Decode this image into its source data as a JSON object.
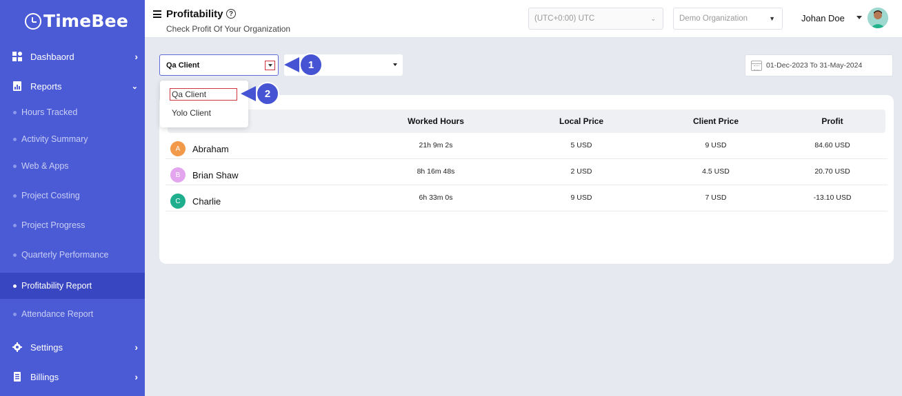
{
  "brand": {
    "logo_text": "TimeBee"
  },
  "sidebar": {
    "dashboard": "Dashbaord",
    "reports": "Reports",
    "sub_items": [
      "Hours Tracked",
      "Activity Summary",
      "Web & Apps",
      "Project Costing",
      "Project Progress",
      "Quarterly Performance",
      "Profitability Report",
      "Attendance Report"
    ],
    "active_item": "Profitability Report",
    "settings": "Settings",
    "billings": "Billings"
  },
  "header": {
    "title": "Profitability",
    "subtitle": "Check Profit Of Your Organization",
    "timezone": "(UTC+0:00) UTC",
    "organization": "Demo Organization",
    "user_name": "Johan Doe"
  },
  "filters": {
    "client_selected": "Qa Client",
    "client_options": [
      "Qa Client",
      "Yolo Client"
    ],
    "date_range": "01-Dec-2023 To 31-May-2024"
  },
  "callouts": [
    "1",
    "2"
  ],
  "table": {
    "headers": [
      "Worked Hours",
      "Local Price",
      "Client Price",
      "Profit"
    ],
    "rows": [
      {
        "initial": "A",
        "name": "Abraham",
        "worked_hours": "21h 9m 2s",
        "local_price": "5 USD",
        "client_price": "9 USD",
        "profit": "84.60 USD",
        "color": "#f2994a"
      },
      {
        "initial": "B",
        "name": "Brian Shaw",
        "worked_hours": "8h 16m 48s",
        "local_price": "2 USD",
        "client_price": "4.5 USD",
        "profit": "20.70 USD",
        "color": "#e3a5ee"
      },
      {
        "initial": "C",
        "name": "Charlie",
        "worked_hours": "6h 33m 0s",
        "local_price": "9 USD",
        "client_price": "7 USD",
        "profit": "-13.10 USD",
        "color": "#1fae8e"
      }
    ]
  },
  "colors": {
    "sidebar": "#4b5bd6",
    "sidebar_active": "#3946c2",
    "callout": "#4654d4",
    "highlight": "#d0343f"
  }
}
